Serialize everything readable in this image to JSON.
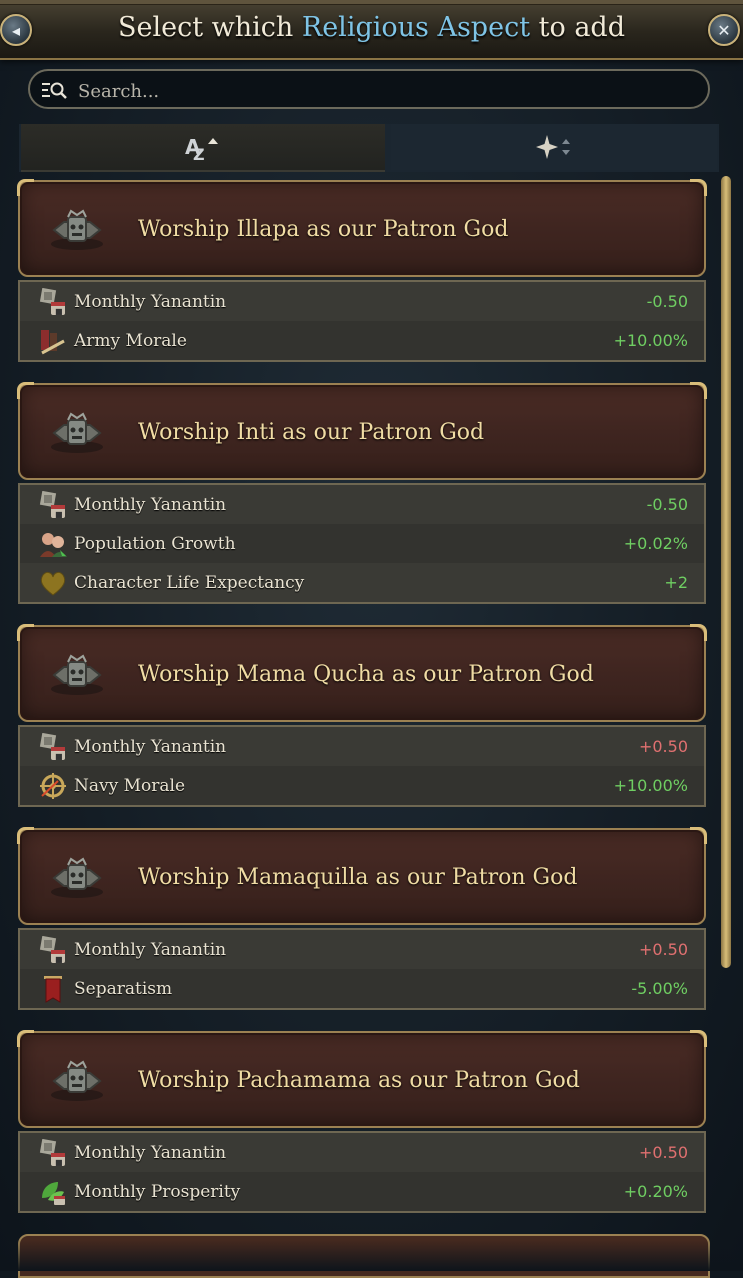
{
  "header": {
    "title_prefix": "Select which ",
    "title_highlight": "Religious Aspect",
    "title_suffix": " to add",
    "back_icon": "back-arrow-icon",
    "close_icon": "close-icon"
  },
  "search": {
    "placeholder": "Search..."
  },
  "sort_tabs": [
    {
      "icon": "sort-alphabetical-icon",
      "active": true
    },
    {
      "icon": "sort-special-icon",
      "active": false
    }
  ],
  "colors": {
    "positive": "#6fce62",
    "negative": "#e07070",
    "accent_blue": "#7fc4e6",
    "gold_border": "#9b8152"
  },
  "aspects": [
    {
      "title": "Worship Illapa as our Patron God",
      "icon": "illapa-god-icon",
      "effects": [
        {
          "icon": "yanantin-icon",
          "label": "Monthly Yanantin",
          "value": "-0.50",
          "good": true
        },
        {
          "icon": "army-morale-icon",
          "label": "Army Morale",
          "value": "+10.00%",
          "good": true
        }
      ]
    },
    {
      "title": "Worship Inti as our Patron God",
      "icon": "inti-god-icon",
      "effects": [
        {
          "icon": "yanantin-icon",
          "label": "Monthly Yanantin",
          "value": "-0.50",
          "good": true
        },
        {
          "icon": "population-growth-icon",
          "label": "Population Growth",
          "value": "+0.02%",
          "good": true
        },
        {
          "icon": "heart-icon",
          "label": "Character Life Expectancy",
          "value": "+2",
          "good": true
        }
      ]
    },
    {
      "title": "Worship Mama Qucha as our Patron God",
      "icon": "mama-qucha-god-icon",
      "effects": [
        {
          "icon": "yanantin-icon",
          "label": "Monthly Yanantin",
          "value": "+0.50",
          "good": false
        },
        {
          "icon": "navy-morale-icon",
          "label": "Navy Morale",
          "value": "+10.00%",
          "good": true
        }
      ]
    },
    {
      "title": "Worship Mamaquilla as our Patron God",
      "icon": "mamaquilla-god-icon",
      "effects": [
        {
          "icon": "yanantin-icon",
          "label": "Monthly Yanantin",
          "value": "+0.50",
          "good": false
        },
        {
          "icon": "separatism-banner-icon",
          "label": "Separatism",
          "value": "-5.00%",
          "good": true
        }
      ]
    },
    {
      "title": "Worship Pachamama as our Patron God",
      "icon": "pachamama-god-icon",
      "effects": [
        {
          "icon": "yanantin-icon",
          "label": "Monthly Yanantin",
          "value": "+0.50",
          "good": false
        },
        {
          "icon": "prosperity-leaf-icon",
          "label": "Monthly Prosperity",
          "value": "+0.20%",
          "good": true
        }
      ]
    }
  ]
}
